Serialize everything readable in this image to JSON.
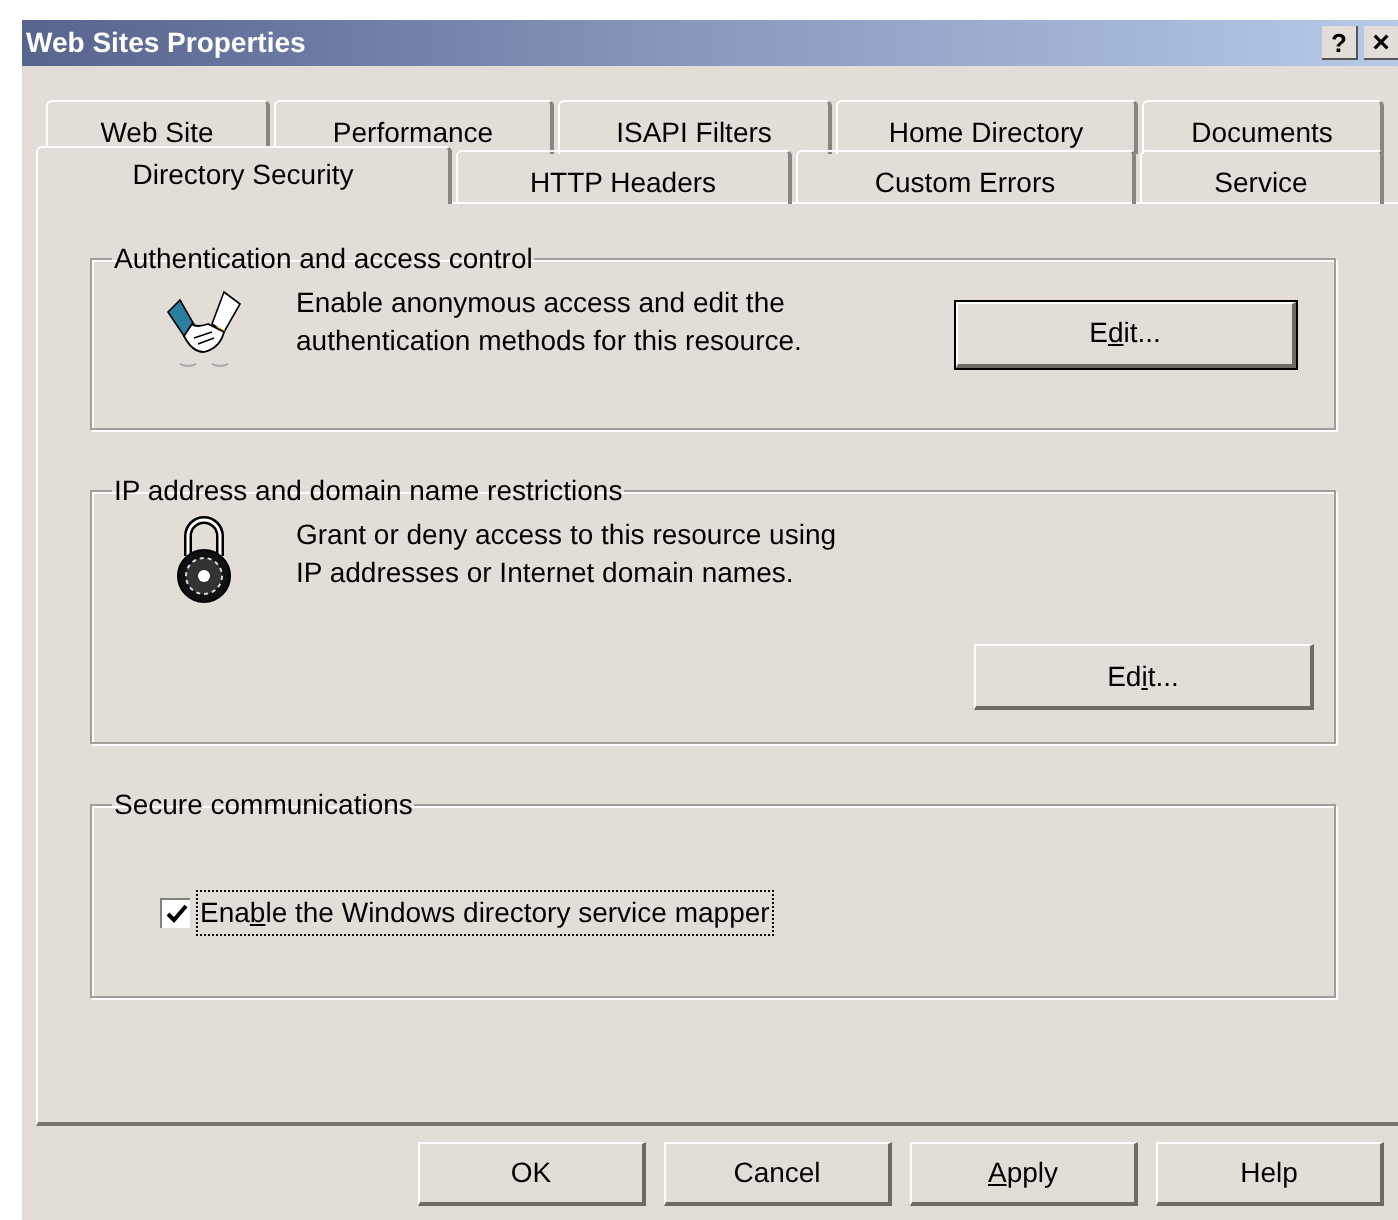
{
  "window": {
    "title": "Web Sites Properties",
    "help_button": "?",
    "close_button": "×"
  },
  "tab_rows": [
    {
      "tabs": [
        {
          "label": "Web Site",
          "selected": false
        },
        {
          "label": "Performance",
          "selected": false
        },
        {
          "label": "ISAPI Filters",
          "selected": false
        },
        {
          "label": "Home Directory",
          "selected": false
        },
        {
          "label": "Documents",
          "selected": false
        }
      ]
    },
    {
      "tabs": [
        {
          "label": "Directory Security",
          "selected": true
        },
        {
          "label": "HTTP Headers",
          "selected": false
        },
        {
          "label": "Custom Errors",
          "selected": false
        },
        {
          "label": "Service",
          "selected": false
        }
      ]
    }
  ],
  "groups": [
    {
      "title": "Authentication and access control",
      "kind": "handshake",
      "text": "Enable anonymous access and edit the\nauthentication methods for this resource.",
      "button": {
        "label_before": "E",
        "access_key": "d",
        "label_after": "it...",
        "default": true
      }
    },
    {
      "title": "IP address and domain name restrictions",
      "kind": "lock",
      "text": "Grant or deny access to this resource using\nIP addresses or Internet domain names.",
      "button": {
        "label_before": "Ed",
        "access_key": "i",
        "label_after": "t...",
        "default": false
      }
    },
    {
      "title": "Secure communications",
      "kind": "checkbox",
      "checkbox": {
        "label_before": "Ena",
        "access_key": "b",
        "label_after": "le the Windows directory service mapper",
        "checked": true,
        "focused": true
      }
    }
  ],
  "buttons": [
    {
      "label_before": "OK"
    },
    {
      "label_before": "Cancel"
    },
    {
      "access_key": "A",
      "label_after": "pply"
    },
    {
      "label_before": "Help"
    }
  ]
}
